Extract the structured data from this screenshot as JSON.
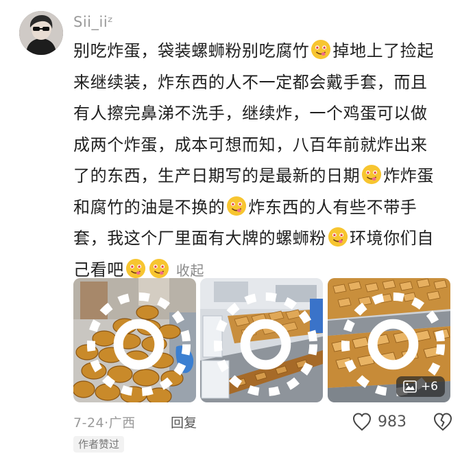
{
  "comment": {
    "username": "Sii_iiᶻ",
    "lines": [
      {
        "parts": [
          "别吃炸蛋，袋装螺蛳粉别吃腐竹",
          "掉地上了捡起"
        ]
      },
      {
        "parts": [
          "来继续装，炸东西的人不一定都会戴手套，而且"
        ]
      },
      {
        "parts": [
          "有人擦完鼻涕不洗手，继续炸，一个鸡蛋可以做"
        ]
      },
      {
        "parts": [
          "成两个炸蛋，成本可想而知，八百年前就炸出来"
        ]
      },
      {
        "parts": [
          "了的东西，生产日期写的是最新的日期",
          "炸炸蛋"
        ]
      },
      {
        "parts": [
          "和腐竹的油是不换的",
          "炸东西的人有些不带手"
        ]
      },
      {
        "parts": [
          "套，我这个厂里面有大牌的螺蛳粉",
          "环境你们自"
        ]
      },
      {
        "parts": [
          "己看吧"
        ]
      }
    ],
    "collapse_label": "收起",
    "emoji_icon": "savoring-food-face-icon",
    "media": {
      "image_count": 3,
      "more_label": "+6",
      "captions": [
        "fried-egg-pile",
        "fried-food-conveyor",
        "tofu-skin-conveyor"
      ]
    },
    "date": "7-24",
    "location": "广西",
    "reply_label": "回复",
    "like_count": "983",
    "author_liked_badge": "作者赞过"
  },
  "colors": {
    "accent_muted": "#9a9a9a",
    "badge_bg": "#f2f2f2",
    "emoji_yellow": "#f7c530"
  }
}
